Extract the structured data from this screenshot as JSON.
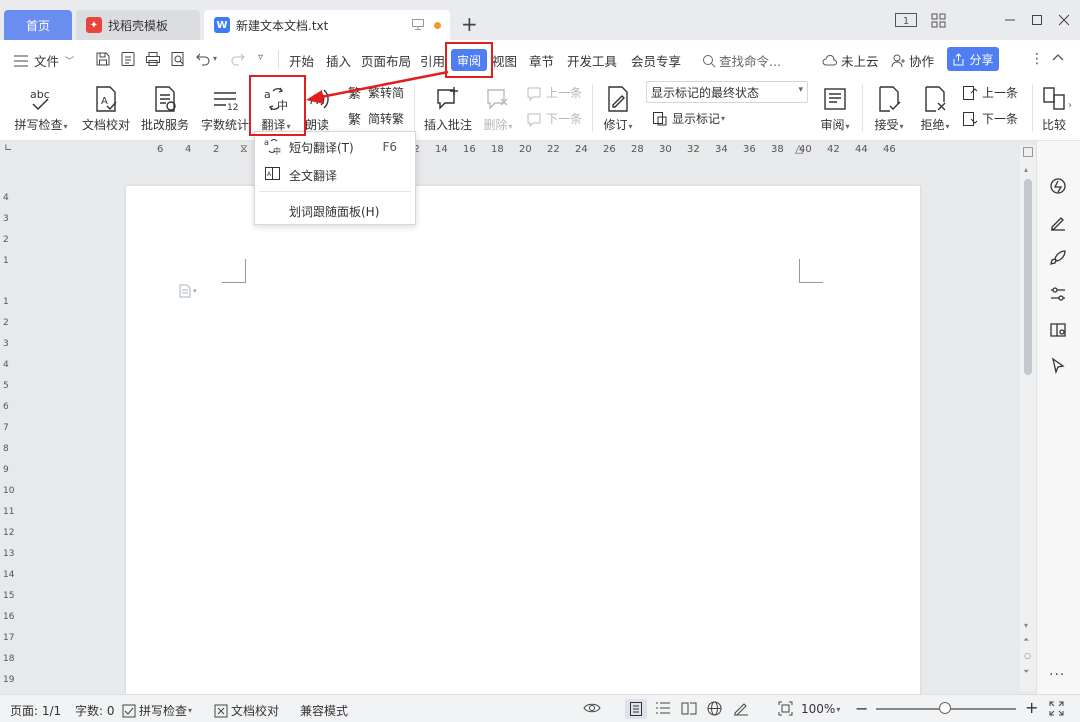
{
  "titlebar": {
    "home_tab": "首页",
    "template_tab": "找稻壳模板",
    "doc_tab": "新建文本文档.txt",
    "new_tab": "+",
    "layout_badge": "1"
  },
  "menu": {
    "file": "文件",
    "items": [
      "开始",
      "插入",
      "页面布局",
      "引用",
      "审阅",
      "视图",
      "章节",
      "开发工具",
      "会员专享"
    ],
    "search_placeholder": "查找命令...",
    "cloud": "未上云",
    "collab": "协作",
    "share": "分享"
  },
  "ribbon": {
    "spell_check": "拼写检查",
    "doc_proof": "文档校对",
    "revise_service": "批改服务",
    "word_count": "字数统计",
    "translate": "翻译",
    "read_aloud": "朗读",
    "trad_to_simp": "繁转简",
    "simp_to_trad": "简转繁",
    "insert_comment": "插入批注",
    "delete": "删除",
    "prev_comment": "上一条",
    "next_comment": "下一条",
    "track_changes": "修订",
    "markup_select": "显示标记的最终状态",
    "show_markup": "显示标记",
    "review": "审阅",
    "accept": "接受",
    "reject": "拒绝",
    "prev_change": "上一条",
    "next_change": "下一条",
    "compare": "比较"
  },
  "dropdown": {
    "sentence_translate": "短句翻译(T)",
    "sentence_key": "F6",
    "full_translate": "全文翻译",
    "word_panel": "划词跟随面板(H)"
  },
  "ruler": {
    "h_ticks": [
      "6",
      "4",
      "2",
      "2",
      "4",
      "12",
      "14",
      "16",
      "18",
      "20",
      "22",
      "24",
      "26",
      "28",
      "30",
      "32",
      "34",
      "36",
      "38",
      "40",
      "42",
      "44",
      "46"
    ],
    "v_ticks": [
      "4",
      "3",
      "2",
      "1",
      "1",
      "2",
      "3",
      "4",
      "5",
      "6",
      "7",
      "8",
      "9",
      "10",
      "11",
      "12",
      "13",
      "14",
      "15",
      "16",
      "17",
      "18",
      "19"
    ]
  },
  "status": {
    "page": "页面: 1/1",
    "words": "字数: 0",
    "spell": "拼写检查",
    "proof": "文档校对",
    "compat": "兼容模式",
    "zoom": "100%"
  },
  "colors": {
    "accent": "#4f7df2",
    "highlight": "#e02020",
    "home_tab": "#6a8ef0"
  }
}
